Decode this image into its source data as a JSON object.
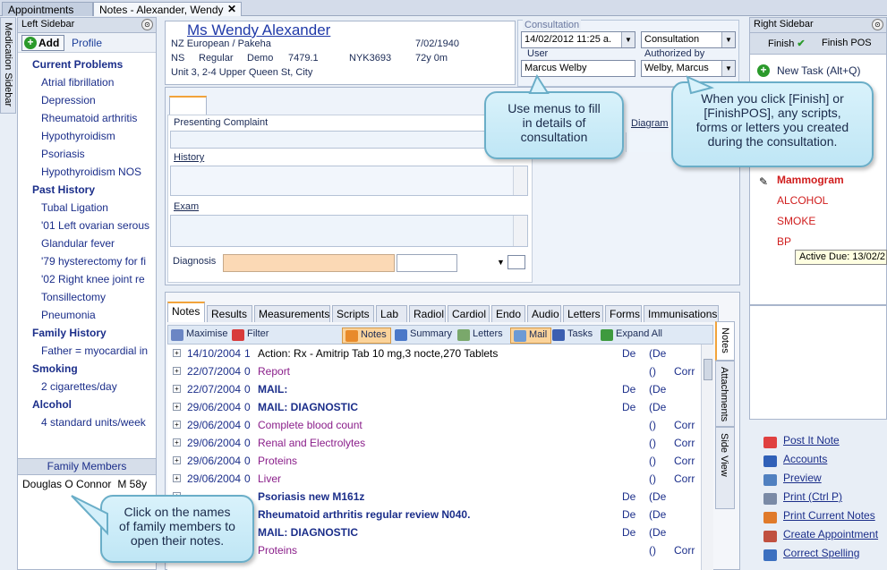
{
  "tabs": {
    "appointments": "Appointments",
    "notes": "Notes - Alexander, Wendy",
    "close": "✕"
  },
  "left_strip": {
    "label": "Medication Sidebar"
  },
  "left_sidebar": {
    "title": "Left Sidebar",
    "add_label": "Add",
    "profile_label": "Profile",
    "items": [
      {
        "text": "Current Problems",
        "type": "h"
      },
      {
        "text": "Atrial fibrillation",
        "type": "i"
      },
      {
        "text": "Depression",
        "type": "i"
      },
      {
        "text": "Rheumatoid arthritis",
        "type": "i"
      },
      {
        "text": "Hypothyroidism",
        "type": "i"
      },
      {
        "text": "Psoriasis",
        "type": "i"
      },
      {
        "text": "Hypothyroidism NOS",
        "type": "i"
      },
      {
        "text": "Past History",
        "type": "h"
      },
      {
        "text": "Tubal Ligation",
        "type": "i"
      },
      {
        "text": "'01 Left ovarian serous",
        "type": "i"
      },
      {
        "text": "Glandular fever",
        "type": "i"
      },
      {
        "text": "'79 hysterectomy for fi",
        "type": "i"
      },
      {
        "text": "'02 Right knee joint re",
        "type": "i"
      },
      {
        "text": "Tonsillectomy",
        "type": "i"
      },
      {
        "text": "Pneumonia",
        "type": "i"
      },
      {
        "text": "Family History",
        "type": "h"
      },
      {
        "text": "Father = myocardial in",
        "type": "i"
      },
      {
        "text": "Smoking",
        "type": "h"
      },
      {
        "text": "2 cigarettes/day",
        "type": "i"
      },
      {
        "text": "Alcohol",
        "type": "h"
      },
      {
        "text": "4 standard units/week",
        "type": "i"
      }
    ]
  },
  "family": {
    "title": "Family Members",
    "member_name": "Douglas O Connor",
    "member_age": "M 58y"
  },
  "patient": {
    "name": "Ms Wendy Alexander",
    "ethnicity": "NZ European / Pakeha",
    "dob": "7/02/1940",
    "ns": "NS",
    "status": "Regular",
    "demo": "Demo",
    "demo_id": "7479.1",
    "nhi": "NYK3693",
    "age": "72y 0m",
    "address": "Unit 3, 2-4 Upper Queen St, City"
  },
  "consultation": {
    "label": "Consultation",
    "datetime": "14/02/2012 11:25 a.",
    "type": "Consultation",
    "user_label": "User",
    "user": "Marcus Welby",
    "auth_label": "Authorized by",
    "authorized": "Welby, Marcus"
  },
  "form": {
    "presenting": "Presenting Complaint",
    "history": "History",
    "exam": "Exam",
    "diagnosis": "Diagnosis",
    "diagram": "Diagram"
  },
  "notes": {
    "subtabs": [
      "Notes",
      "Results",
      "Measurements",
      "Scripts",
      "Lab",
      "Radiol",
      "Cardiol",
      "Endo",
      "Audio",
      "Letters",
      "Forms",
      "Immunisations"
    ],
    "toolbar": {
      "maximise": "Maximise",
      "filter": "Filter",
      "notes": "Notes",
      "summary": "Summary",
      "letters": "Letters",
      "mail": "Mail",
      "tasks": "Tasks",
      "expand": "Expand All"
    },
    "side_tabs": [
      "Notes",
      "Attachments",
      "Side View"
    ],
    "rows": [
      {
        "date": "14/10/2004",
        "num": "1",
        "desc": "Action: Rx - Amitrip Tab 10 mg,3 nocte,270 Tablets",
        "by": "De",
        "ws": "(De",
        "cr": "",
        "style": "normal"
      },
      {
        "date": "22/07/2004",
        "num": "0",
        "desc": "Report",
        "by": "",
        "ws": "()",
        "cr": "Corr",
        "style": "purple"
      },
      {
        "date": "22/07/2004",
        "num": "0",
        "desc": "MAIL:",
        "by": "De",
        "ws": "(De",
        "cr": "",
        "style": "bold"
      },
      {
        "date": "29/06/2004",
        "num": "0",
        "desc": "MAIL: DIAGNOSTIC",
        "by": "De",
        "ws": "(De",
        "cr": "",
        "style": "bold"
      },
      {
        "date": "29/06/2004",
        "num": "0",
        "desc": "Complete blood count",
        "by": "",
        "ws": "()",
        "cr": "Corr",
        "style": "purple"
      },
      {
        "date": "29/06/2004",
        "num": "0",
        "desc": "Renal and Electrolytes",
        "by": "",
        "ws": "()",
        "cr": "Corr",
        "style": "purple"
      },
      {
        "date": "29/06/2004",
        "num": "0",
        "desc": "Proteins",
        "by": "",
        "ws": "()",
        "cr": "Corr",
        "style": "purple"
      },
      {
        "date": "29/06/2004",
        "num": "0",
        "desc": "Liver",
        "by": "",
        "ws": "()",
        "cr": "Corr",
        "style": "purple"
      },
      {
        "date": "",
        "num": "",
        "desc": "Psoriasis new M161z",
        "by": "De",
        "ws": "(De",
        "cr": "",
        "style": "bold"
      },
      {
        "date": "",
        "num": "",
        "desc": "Rheumatoid arthritis regular review N040.",
        "by": "De",
        "ws": "(De",
        "cr": "",
        "style": "bold"
      },
      {
        "date": "",
        "num": "",
        "desc": "MAIL: DIAGNOSTIC",
        "by": "De",
        "ws": "(De",
        "cr": "",
        "style": "bold"
      },
      {
        "date": "",
        "num": "",
        "desc": "Proteins",
        "by": "",
        "ws": "()",
        "cr": "Corr",
        "style": "purple"
      }
    ]
  },
  "right_sidebar": {
    "title": "Right Sidebar",
    "finish": "Finish",
    "finish_pos": "Finish POS",
    "new_task": "New Task (Alt+Q)",
    "tasks": [
      "Mammogram",
      "ALCOHOL",
      "SMOKE",
      "BP"
    ],
    "active_due": "Active Due: 13/02/2"
  },
  "right_actions": [
    "Post It Note",
    "Accounts",
    "Preview",
    "Print (Ctrl P)",
    "Print Current Notes",
    "Create Appointment",
    "Correct Spelling"
  ],
  "callouts": {
    "menus": [
      "Use menus to fill",
      "in details of",
      "consultation"
    ],
    "finish": [
      "When you click [Finish] or",
      "[FinishPOS], any scripts,",
      "forms or letters you created",
      "during the consultation."
    ],
    "family": [
      "Click on the names",
      "of family members to",
      "open their notes."
    ]
  },
  "colors": {
    "accent": "#f2a33a",
    "link": "#1b2e8a",
    "task_red": "#d01d1d",
    "callout": "#bfe6f5"
  }
}
